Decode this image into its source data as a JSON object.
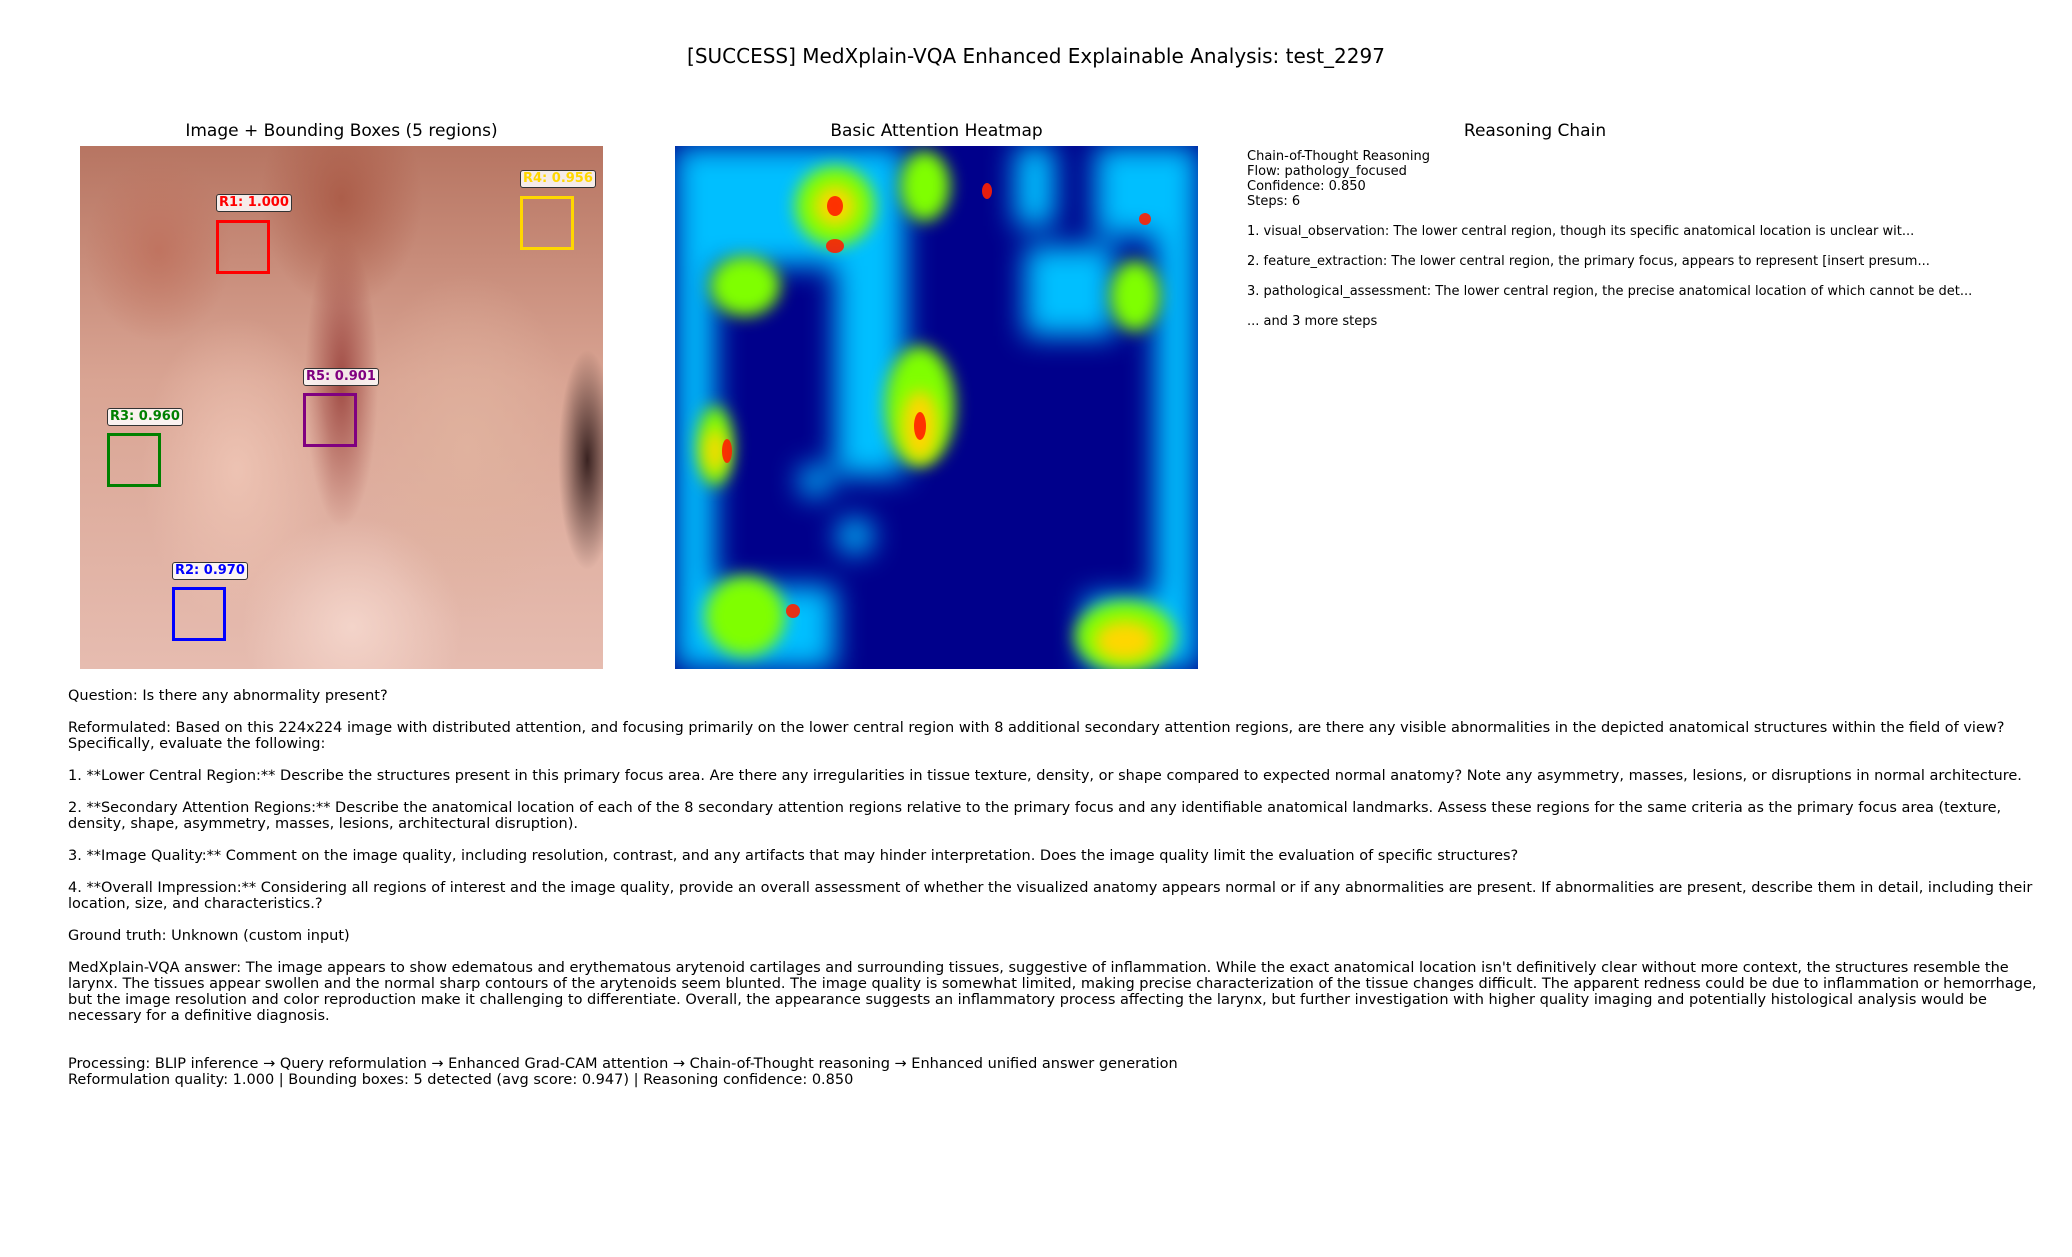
{
  "title": "[SUCCESS] MedXplain-VQA Enhanced  Explainable Analysis: test_2297",
  "panels": {
    "image_title": "Image + Bounding Boxes (5 regions)",
    "heatmap_title": "Basic Attention Heatmap",
    "reasoning_title": "Reasoning Chain"
  },
  "regions": [
    {
      "label": "R1: 1.000",
      "color": "#ff0000"
    },
    {
      "label": "R2: 0.970",
      "color": "#0000ff"
    },
    {
      "label": "R3: 0.960",
      "color": "#008000"
    },
    {
      "label": "R4: 0.956",
      "color": "#ffd700"
    },
    {
      "label": "R5: 0.901",
      "color": "#800080"
    }
  ],
  "reasoning": {
    "header": "Chain-of-Thought Reasoning",
    "flow": "Flow: pathology_focused",
    "confidence": "Confidence: 0.850",
    "steps": "Steps: 6",
    "step1": "1. visual_observation: The lower central region, though its specific anatomical location is unclear wit...",
    "step2": "2. feature_extraction: The lower central region, the primary focus, appears to represent [insert presum...",
    "step3": "3. pathological_assessment: The lower central region, the precise anatomical location of which cannot be det...",
    "more": "... and 3 more steps"
  },
  "analysis": {
    "question": "Question: Is there any abnormality present?",
    "reformulated": "Reformulated: Based on this 224x224 image with distributed attention, and focusing primarily on the lower central region with 8 additional secondary attention regions, are there any visible abnormalities in the depicted anatomical structures within the field of view?  Specifically, evaluate the following:",
    "point1": "1. **Lower Central Region:** Describe the structures present in this primary focus area.  Are there any irregularities in tissue texture, density, or shape compared to expected normal anatomy?  Note any asymmetry, masses, lesions, or disruptions in normal architecture.",
    "point2": "2. **Secondary Attention Regions:**  Describe the anatomical location of each of the 8 secondary attention regions relative to the primary focus and any identifiable anatomical landmarks.  Assess these regions for the same criteria as the primary focus area (texture, density, shape, asymmetry, masses, lesions, architectural disruption).",
    "point3": "3. **Image Quality:** Comment on the image quality, including resolution, contrast, and any artifacts that may hinder interpretation.  Does the image quality limit the evaluation of specific structures?",
    "point4": "4. **Overall Impression:**  Considering all regions of interest and the image quality, provide an overall assessment of whether the visualized anatomy appears normal or if any abnormalities are present.  If abnormalities are present, describe them in detail, including their location, size, and characteristics.?",
    "ground_truth": "Ground truth: Unknown (custom input)",
    "answer": "MedXplain-VQA answer: The image appears to show edematous and erythematous arytenoid cartilages and surrounding tissues, suggestive of inflammation.  While the exact anatomical location isn't definitively clear without more context, the structures resemble the larynx.  The tissues appear swollen and the normal sharp contours of the arytenoids seem blunted.  The image quality is somewhat limited, making precise characterization of the tissue changes difficult.  The apparent redness could be due to inflammation or hemorrhage, but the image resolution and color reproduction make it challenging to differentiate.  Overall, the appearance suggests an inflammatory process affecting the larynx, but further investigation with higher quality imaging and potentially histological analysis would be necessary for a definitive diagnosis.",
    "processing": "Processing: BLIP inference → Query reformulation → Enhanced Grad-CAM attention → Chain-of-Thought reasoning → Enhanced unified answer generation",
    "quality": "Reformulation quality: 1.000 | Bounding boxes: 5 detected (avg score: 0.947) | Reasoning confidence: 0.850"
  }
}
